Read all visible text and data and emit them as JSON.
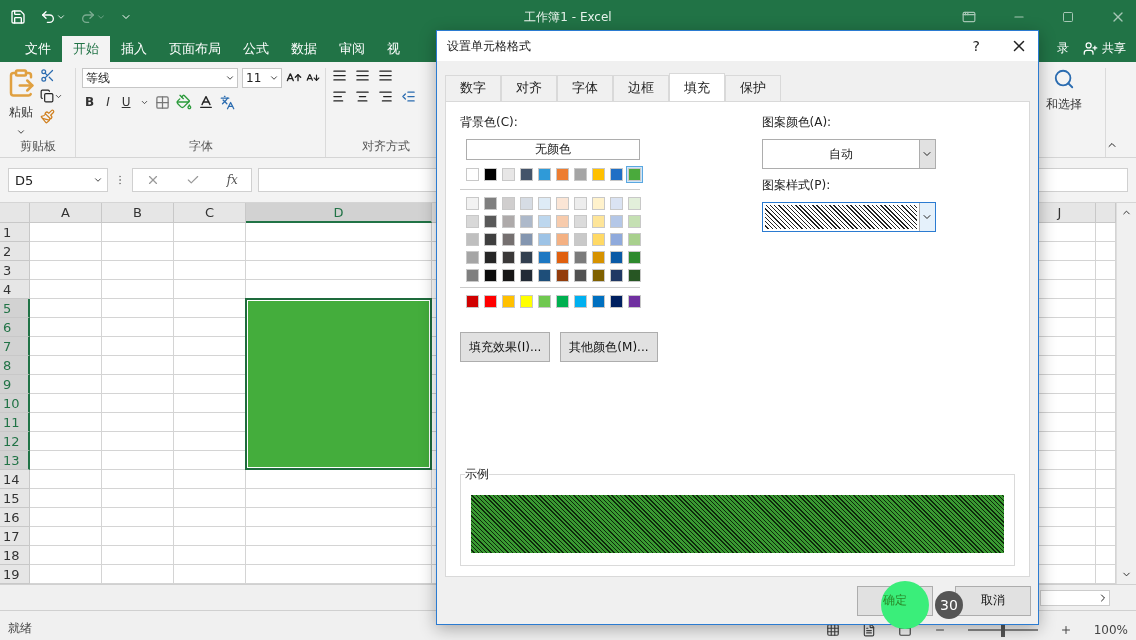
{
  "window": {
    "title": "工作簿1 - Excel"
  },
  "ribbon_tabs": [
    {
      "label": "文件",
      "selected": false
    },
    {
      "label": "开始",
      "selected": true
    },
    {
      "label": "插入",
      "selected": false
    },
    {
      "label": "页面布局",
      "selected": false
    },
    {
      "label": "公式",
      "selected": false
    },
    {
      "label": "数据",
      "selected": false
    },
    {
      "label": "审阅",
      "selected": false
    },
    {
      "label": "视",
      "selected": false
    }
  ],
  "account": {
    "sign_in": "录",
    "share": "共享"
  },
  "ribbon": {
    "paste": "粘贴",
    "clipboard_group": "剪贴板",
    "font_name": "等线",
    "font_size": "11",
    "bold": "B",
    "italic": "I",
    "underline": "U",
    "font_group": "字体",
    "alignment_group": "对齐方式",
    "find_select": "和选择"
  },
  "formula_bar": {
    "name_box": "D5",
    "fx": "fx"
  },
  "columns": [
    {
      "label": "A",
      "kind": "normal",
      "selected": false
    },
    {
      "label": "B",
      "kind": "normal",
      "selected": false
    },
    {
      "label": "C",
      "kind": "normal",
      "selected": false
    },
    {
      "label": "D",
      "kind": "wide",
      "selected": true
    }
  ],
  "right_columns": [
    {
      "label": "J",
      "kind": "normal",
      "selected": false
    }
  ],
  "rows": [
    {
      "label": "1",
      "selected": false
    },
    {
      "label": "2",
      "selected": false
    },
    {
      "label": "3",
      "selected": false
    },
    {
      "label": "4",
      "selected": false
    },
    {
      "label": "5",
      "selected": true
    },
    {
      "label": "6",
      "selected": true
    },
    {
      "label": "7",
      "selected": true
    },
    {
      "label": "8",
      "selected": true
    },
    {
      "label": "9",
      "selected": true
    },
    {
      "label": "10",
      "selected": true
    },
    {
      "label": "11",
      "selected": true
    },
    {
      "label": "12",
      "selected": true
    },
    {
      "label": "13",
      "selected": true
    },
    {
      "label": "14",
      "selected": false
    },
    {
      "label": "15",
      "selected": false
    },
    {
      "label": "16",
      "selected": false
    },
    {
      "label": "17",
      "selected": false
    },
    {
      "label": "18",
      "selected": false
    },
    {
      "label": "19",
      "selected": false
    }
  ],
  "status_bar": {
    "status": "就绪",
    "zoom": "100%",
    "zoom_level": {
      "level": 0.5
    }
  },
  "dialog": {
    "title": "设置单元格格式",
    "help": "?",
    "tabs": [
      {
        "label": "数字",
        "selected": false
      },
      {
        "label": "对齐",
        "selected": false
      },
      {
        "label": "字体",
        "selected": false
      },
      {
        "label": "边框",
        "selected": false
      },
      {
        "label": "填充",
        "selected": true
      },
      {
        "label": "保护",
        "selected": false
      }
    ],
    "background_label": "背景色(C):",
    "no_color": "无颜色",
    "theme_colors": [
      {
        "color": "#ffffff",
        "selected": false
      },
      {
        "color": "#000000",
        "selected": false
      },
      {
        "color": "#e7e6e6",
        "selected": false
      },
      {
        "color": "#44546a",
        "selected": false
      },
      {
        "color": "#2f9ad8",
        "selected": false
      },
      {
        "color": "#ed7d31",
        "selected": false
      },
      {
        "color": "#a5a5a5",
        "selected": false
      },
      {
        "color": "#ffc000",
        "selected": false
      },
      {
        "color": "#1f6fc5",
        "selected": false
      },
      {
        "color": "#4aaa3c",
        "selected": true
      }
    ],
    "tint_rows": [
      {
        "swatches": [
          {
            "color": "#f2f2f2"
          },
          {
            "color": "#7f7f7f"
          },
          {
            "color": "#d0cece"
          },
          {
            "color": "#d6dce4"
          },
          {
            "color": "#deebf6"
          },
          {
            "color": "#fbe5d5"
          },
          {
            "color": "#ededed"
          },
          {
            "color": "#fff2cc"
          },
          {
            "color": "#dae3f3"
          },
          {
            "color": "#e2efda"
          }
        ]
      },
      {
        "swatches": [
          {
            "color": "#d8d8d8"
          },
          {
            "color": "#595959"
          },
          {
            "color": "#aeaaaa"
          },
          {
            "color": "#adb9ca"
          },
          {
            "color": "#bdd7ee"
          },
          {
            "color": "#f7cbac"
          },
          {
            "color": "#dbdbdb"
          },
          {
            "color": "#fee599"
          },
          {
            "color": "#b4c7e7"
          },
          {
            "color": "#c5e0b3"
          }
        ]
      },
      {
        "swatches": [
          {
            "color": "#bfbfbf"
          },
          {
            "color": "#3f3f3f"
          },
          {
            "color": "#757070"
          },
          {
            "color": "#8496b0"
          },
          {
            "color": "#9dc3e6"
          },
          {
            "color": "#f4b183"
          },
          {
            "color": "#c9c9c9"
          },
          {
            "color": "#ffd965"
          },
          {
            "color": "#8faadc"
          },
          {
            "color": "#a8d08d"
          }
        ]
      },
      {
        "swatches": [
          {
            "color": "#a5a5a5"
          },
          {
            "color": "#262626"
          },
          {
            "color": "#3a3838"
          },
          {
            "color": "#323f4f"
          },
          {
            "color": "#1e78c2"
          },
          {
            "color": "#e0600f"
          },
          {
            "color": "#7b7b7b"
          },
          {
            "color": "#d69200"
          },
          {
            "color": "#0a5aa6"
          },
          {
            "color": "#2e8a2e"
          }
        ]
      },
      {
        "swatches": [
          {
            "color": "#7f7f7f"
          },
          {
            "color": "#0c0c0c"
          },
          {
            "color": "#171616"
          },
          {
            "color": "#222a35"
          },
          {
            "color": "#1e4e79"
          },
          {
            "color": "#933c0b"
          },
          {
            "color": "#525252"
          },
          {
            "color": "#7f6000"
          },
          {
            "color": "#203864"
          },
          {
            "color": "#275623"
          }
        ]
      }
    ],
    "standard_colors": [
      {
        "color": "#d00000",
        "selected": false
      },
      {
        "color": "#ff0000",
        "selected": false
      },
      {
        "color": "#ffc000",
        "selected": false
      },
      {
        "color": "#ffff00",
        "selected": false
      },
      {
        "color": "#70c850",
        "selected": false
      },
      {
        "color": "#00b050",
        "selected": false
      },
      {
        "color": "#00b0f0",
        "selected": false
      },
      {
        "color": "#0070c0",
        "selected": false
      },
      {
        "color": "#002060",
        "selected": false
      },
      {
        "color": "#7030a0",
        "selected": false
      }
    ],
    "fill_effects": "填充效果(I)...",
    "more_colors": "其他颜色(M)...",
    "pattern_color_label": "图案颜色(A):",
    "pattern_color": "自动",
    "pattern_style_label": "图案样式(P):",
    "sample_label": "示例",
    "buttons": [
      {
        "label": "确定",
        "highlighted": true
      },
      {
        "label": "取消",
        "highlighted": false
      }
    ],
    "step_badge": "30"
  }
}
